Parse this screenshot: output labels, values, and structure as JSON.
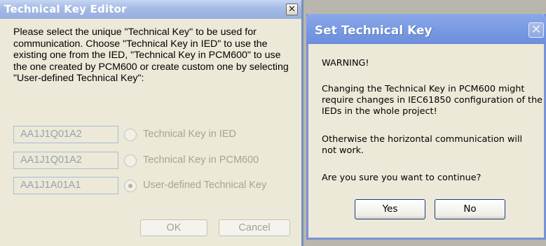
{
  "editor": {
    "title": "Technical Key Editor",
    "close_glyph": "✕",
    "description": "Please select the unique \"Technical Key\" to be used for communication.  Choose \"Technical Key in IED\" to use the existing one from the IED, \"Technical Key in PCM600\" to use the one created by PCM600 or create custom one by selecting  \"User-defined Technical Key\":",
    "options": [
      {
        "key_value": "AA1J1Q01A2",
        "label": "Technical Key in IED",
        "selected": false
      },
      {
        "key_value": "AA1J1Q01A2",
        "label": "Technical Key in PCM600",
        "selected": false
      },
      {
        "key_value": "AA1J1A01A1",
        "label": "User-defined Technical Key",
        "selected": true
      }
    ],
    "ok_label": "OK",
    "cancel_label": "Cancel"
  },
  "confirm": {
    "title": "Set Technical Key",
    "close_glyph": "✕",
    "warning": "WARNING!",
    "message1": "Changing the Technical Key in PCM600 might require changes in IEC61850 configuration of the IEDs in the whole project!",
    "message2": "Otherwise the horizontal communication will not work.",
    "question": "Are you sure you want to continue?",
    "yes_label": "Yes",
    "no_label": "No"
  },
  "colors": {
    "accent_title": "#7b9be4",
    "disabled_text": "#a7a494"
  }
}
